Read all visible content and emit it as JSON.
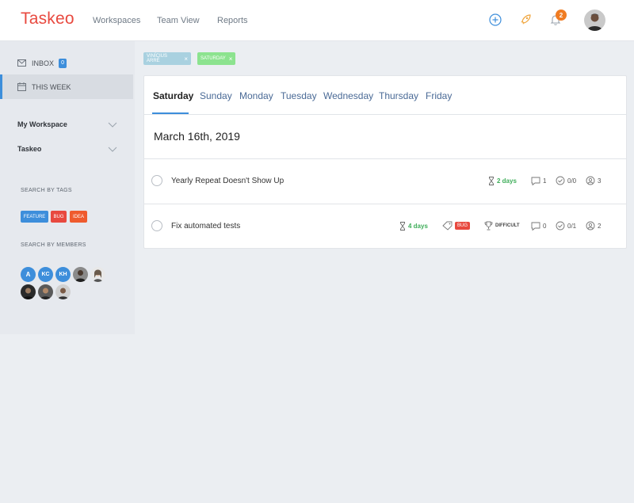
{
  "app": {
    "logo": "Taskeo"
  },
  "nav": [
    "Workspaces",
    "Team View",
    "Reports"
  ],
  "notifications": {
    "count": "2"
  },
  "sidebar": {
    "inbox": {
      "label": "INBOX",
      "count": "0"
    },
    "this_week": {
      "label": "THIS WEEK"
    },
    "workspaces": [
      "My Workspace",
      "Taskeo"
    ],
    "search_tags_title": "SEARCH BY TAGS",
    "tags": [
      {
        "label": "FEATURE",
        "color": "#3d8edb"
      },
      {
        "label": "BUG",
        "color": "#e8493f"
      },
      {
        "label": "IDEA",
        "color": "#ef5b2e"
      }
    ],
    "search_members_title": "SEARCH BY MEMBERS",
    "member_initials": [
      "A",
      "KC",
      "KH"
    ]
  },
  "filters": {
    "member": "VINÍCIUS ARRÉ",
    "day": "SATURDAY"
  },
  "tabs": [
    "Saturday",
    "Sunday",
    "Monday",
    "Tuesday",
    "Wednesday",
    "Thursday",
    "Friday"
  ],
  "date_heading": "March 16th, 2019",
  "tasks": [
    {
      "title": "Yearly Repeat Doesn't Show Up",
      "duration": "2 days",
      "comments": "1",
      "checklist": "0/0",
      "members": "3"
    },
    {
      "title": "Fix automated tests",
      "duration": "4 days",
      "tag": "BUG",
      "difficulty": "DIFFICULT",
      "comments": "0",
      "checklist": "0/1",
      "members": "2"
    }
  ],
  "colors": {
    "brand": "#e8493f",
    "accent": "#3d8edb",
    "success": "#3fae5a",
    "notification": "#f07c22"
  }
}
